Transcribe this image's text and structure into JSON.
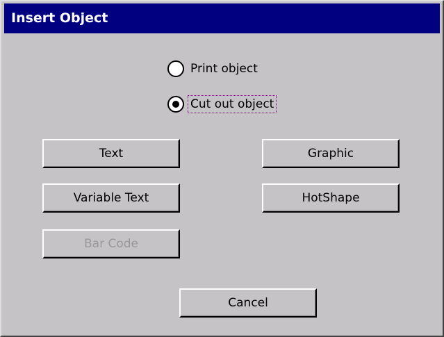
{
  "window": {
    "title": "Insert Object"
  },
  "options": {
    "print_label": "Print object",
    "cutout_label": "Cut out object",
    "selected": "Cut out object"
  },
  "buttons": {
    "text": "Text",
    "variable_text": "Variable Text",
    "bar_code": "Bar Code",
    "graphic": "Graphic",
    "hotshape": "HotShape",
    "cancel": "Cancel"
  }
}
